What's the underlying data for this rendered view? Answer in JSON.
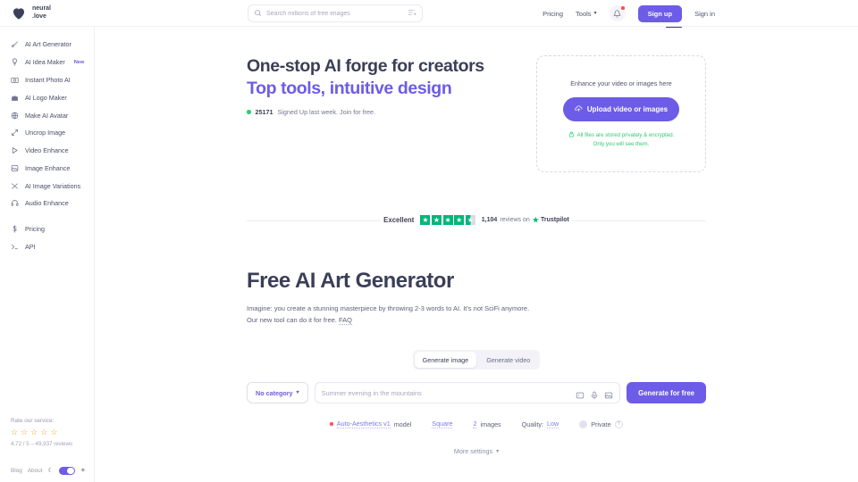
{
  "brand": {
    "name_line1": "neural",
    "name_line2": ".love",
    "logo_icon": "heart-logo-icon"
  },
  "header": {
    "search": {
      "placeholder": "Search millions of free images",
      "value": "",
      "search_icon": "search-icon",
      "filter_icon": "filter-sliders-icon"
    },
    "pricing_label": "Pricing",
    "tools_label": "Tools",
    "bell_icon": "bell-icon",
    "signup_label": "Sign up",
    "signin_label": "Sign in"
  },
  "sidebar": {
    "items": [
      {
        "label": "AI Art Generator",
        "icon": "brush-icon",
        "badge": ""
      },
      {
        "label": "AI Idea Maker",
        "icon": "lightbulb-icon",
        "badge": "New"
      },
      {
        "label": "Instant Photo AI",
        "icon": "camera-icon",
        "badge": ""
      },
      {
        "label": "AI Logo Maker",
        "icon": "castle-icon",
        "badge": ""
      },
      {
        "label": "Make AI Avatar",
        "icon": "globe-icon",
        "badge": ""
      },
      {
        "label": "Uncrop Image",
        "icon": "expand-icon",
        "badge": ""
      },
      {
        "label": "Video Enhance",
        "icon": "play-icon",
        "badge": ""
      },
      {
        "label": "Image Enhance",
        "icon": "image-icon",
        "badge": ""
      },
      {
        "label": "AI Image Variations",
        "icon": "shuffle-icon",
        "badge": ""
      },
      {
        "label": "Audio Enhance",
        "icon": "headphones-icon",
        "badge": ""
      }
    ],
    "secondary": [
      {
        "label": "Pricing",
        "icon": "dollar-icon"
      },
      {
        "label": "API",
        "icon": "terminal-icon"
      }
    ],
    "rating": {
      "label": "Rate our service:",
      "stars": 5,
      "meta": "4.72 / 5 – 49,937 reviews"
    },
    "bottom": {
      "blog_label": "Blog",
      "about_label": "About",
      "moon_icon": "moon-icon",
      "sun_icon": "sun-icon",
      "theme_toggle_on": true
    }
  },
  "hero": {
    "title_line1": "One-stop AI forge for creators",
    "title_line2": "Top tools, intuitive design",
    "signup_count": "25171",
    "signup_text": "Signed Up last week. Join for free.",
    "dropzone": {
      "title": "Enhance your video or images here",
      "button_label": "Upload video or images",
      "upload_icon": "cloud-upload-icon",
      "lock_icon": "lock-icon",
      "note_line1": "All files are stored privately & encrypted.",
      "note_line2": "Only you will see them."
    }
  },
  "trustpilot": {
    "word": "Excellent",
    "stars_filled": 4,
    "stars_half": true,
    "count": "1,104",
    "reviews_text": "reviews on",
    "brand": "Trustpilot",
    "star_icon": "trustpilot-star-icon"
  },
  "generator": {
    "title": "Free AI Art Generator",
    "desc_line1": "Imagine: you create a stunning masterpiece by throwing 2-3 words to AI. It's not SciFi anymore.",
    "desc_line2_pre": "Our new tool can do it for free.",
    "faq_label": "FAQ",
    "tabs": [
      {
        "label": "Generate image",
        "active": true
      },
      {
        "label": "Generate video",
        "active": false
      }
    ],
    "category_label": "No category",
    "prompt_placeholder": "Summer evening in the mountains",
    "prompt_value": "",
    "icons": {
      "expand": "expand-icon",
      "mic": "microphone-icon",
      "image": "image-upload-icon",
      "mascot": "robot-mascot-icon",
      "chevron": "chevron-down-icon"
    },
    "generate_label": "Generate for free",
    "options": {
      "model_label": "Auto-Aesthetics v1",
      "model_suffix": "model",
      "aspect_label": "Square",
      "count_label": "2",
      "count_suffix": "images",
      "quality_prefix": "Quality:",
      "quality_value": "Low",
      "private_label": "Private",
      "help_badge": "?"
    },
    "more_settings_label": "More settings"
  },
  "colors": {
    "accent": "#6c5ce7",
    "green": "#2ecc71",
    "trustpilot_green": "#00b67a",
    "star_orange": "#f5a623",
    "text": "#3b3f57"
  }
}
